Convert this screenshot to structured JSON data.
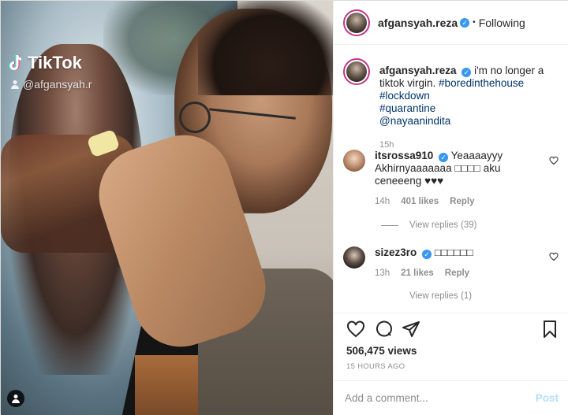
{
  "media": {
    "watermark_brand": "TikTok",
    "watermark_handle": "@afgansyah.r"
  },
  "header": {
    "username": "afgansyah.reza",
    "separator": "•",
    "follow_status": "Following"
  },
  "caption": {
    "username": "afgansyah.reza",
    "text": "i'm no longer a tiktok virgin.",
    "hashtags": [
      "#boredinthehouse",
      "#lockdown",
      "#quarantine"
    ],
    "mention": "@nayaanindita",
    "time": "15h"
  },
  "comments": [
    {
      "username": "itsrossa910",
      "text": "Yeaaaayyy Akhirnyaaaaaaa □□□□ aku ceneeeng ♥♥♥",
      "time": "14h",
      "likes": "401 likes",
      "reply_label": "Reply",
      "view_replies": "View replies (39)"
    },
    {
      "username": "sizez3ro",
      "text": "□□□□□□",
      "time": "13h",
      "likes": "21 likes",
      "reply_label": "Reply",
      "view_replies": "View replies (1)"
    }
  ],
  "stats": {
    "views": "506,475 views",
    "posted": "15 HOURS AGO"
  },
  "add_comment": {
    "placeholder": "Add a comment...",
    "post_label": "Post"
  },
  "colors": {
    "verified": "#3897f0",
    "link": "#003569",
    "muted": "#8e8e8e",
    "post_disabled": "#b2dffc"
  },
  "icons": [
    "like-icon",
    "comment-icon",
    "share-icon",
    "save-icon",
    "verified-icon",
    "user-tag-icon",
    "tiktok-logo-icon"
  ]
}
